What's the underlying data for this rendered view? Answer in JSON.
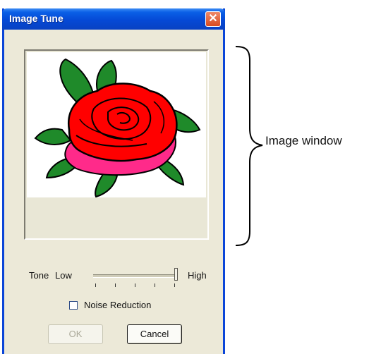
{
  "window": {
    "title": "Image Tune",
    "close_glyph": "✕"
  },
  "tone": {
    "tone_label": "Tone",
    "low_label": "Low",
    "high_label": "High",
    "slider_level": 1.0
  },
  "noise_reduction": {
    "label": "Noise Reduction",
    "checked": false
  },
  "buttons": {
    "ok_label": "OK",
    "ok_enabled": false,
    "cancel_label": "Cancel"
  },
  "annotation": {
    "text": "Image window"
  },
  "icons": [
    "close-icon",
    "rose-image"
  ],
  "colors": {
    "titlebar": "#0549d6",
    "dialog_bg": "#ece9d8",
    "close_button": "#d84b1f",
    "rose_red": "#ff0000",
    "rose_pink": "#ff2a8a",
    "leaf_green": "#1f8a2a"
  }
}
